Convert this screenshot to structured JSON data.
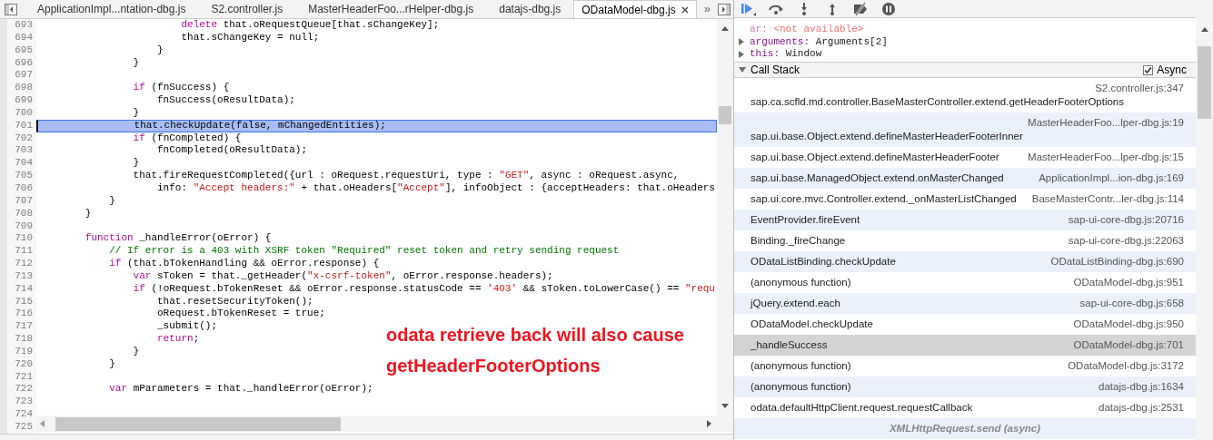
{
  "editor": {
    "tabs": [
      {
        "label": "ApplicationImpl...ntation-dbg.js",
        "selected": false
      },
      {
        "label": "S2.controller.js",
        "selected": false
      },
      {
        "label": "MasterHeaderFoo...rHelper-dbg.js",
        "selected": false
      },
      {
        "label": "datajs-dbg.js",
        "selected": false
      },
      {
        "label": "ODataModel-dbg.js",
        "selected": true
      }
    ],
    "overflow": "»",
    "lines": [
      {
        "number": "693",
        "selected": false,
        "tokens": [
          {
            "kind": "keyword",
            "text": "                        delete"
          },
          {
            "kind": "plain",
            "text": " that.oRequestQueue[that.sChangeKey];"
          }
        ]
      },
      {
        "number": "694",
        "selected": false,
        "tokens": [
          {
            "kind": "plain",
            "text": "                        that.sChangeKey = null;"
          }
        ]
      },
      {
        "number": "695",
        "selected": false,
        "tokens": [
          {
            "kind": "plain",
            "text": "                    }"
          }
        ]
      },
      {
        "number": "696",
        "selected": false,
        "tokens": [
          {
            "kind": "plain",
            "text": "                }"
          }
        ]
      },
      {
        "number": "697",
        "selected": false
      },
      {
        "number": "698",
        "selected": false,
        "tokens": [
          {
            "kind": "keyword",
            "text": "                if"
          },
          {
            "kind": "plain",
            "text": " (fnSuccess) {"
          }
        ]
      },
      {
        "number": "699",
        "selected": false,
        "tokens": [
          {
            "kind": "plain",
            "text": "                    fnSuccess(oResultData);"
          }
        ]
      },
      {
        "number": "700",
        "selected": false,
        "tokens": [
          {
            "kind": "plain",
            "text": "                }"
          }
        ]
      },
      {
        "number": "701",
        "selected": true,
        "tokens": [
          {
            "kind": "plain",
            "text": "                that.checkUpdate(false, mChangedEntities);"
          }
        ]
      },
      {
        "number": "702",
        "selected": false,
        "tokens": [
          {
            "kind": "keyword",
            "text": "                if"
          },
          {
            "kind": "plain",
            "text": " (fnCompleted) {"
          }
        ]
      },
      {
        "number": "703",
        "selected": false,
        "tokens": [
          {
            "kind": "plain",
            "text": "                    fnCompleted(oResultData);"
          }
        ]
      },
      {
        "number": "704",
        "selected": false,
        "tokens": [
          {
            "kind": "plain",
            "text": "                }"
          }
        ]
      },
      {
        "number": "705",
        "selected": false,
        "tokens": [
          {
            "kind": "plain",
            "text": "                that.fireRequestCompleted({url : oRequest.requestUri, type : "
          },
          {
            "kind": "string",
            "text": "\"GET\""
          },
          {
            "kind": "plain",
            "text": ", async : oRequest.async,"
          }
        ]
      },
      {
        "number": "706",
        "selected": false,
        "tokens": [
          {
            "kind": "plain",
            "text": "                    info: "
          },
          {
            "kind": "string",
            "text": "\"Accept headers:\""
          },
          {
            "kind": "plain",
            "text": " + that.oHeaders["
          },
          {
            "kind": "string",
            "text": "\"Accept\""
          },
          {
            "kind": "plain",
            "text": "], infoObject : {acceptHeaders: that.oHeaders"
          }
        ]
      },
      {
        "number": "707",
        "selected": false,
        "tokens": [
          {
            "kind": "plain",
            "text": "            }"
          }
        ]
      },
      {
        "number": "708",
        "selected": false,
        "tokens": [
          {
            "kind": "plain",
            "text": "        }"
          }
        ]
      },
      {
        "number": "709",
        "selected": false
      },
      {
        "number": "710",
        "selected": false,
        "tokens": [
          {
            "kind": "keyword",
            "text": "        function"
          },
          {
            "kind": "plain",
            "text": " _handleError(oError) {"
          }
        ]
      },
      {
        "number": "711",
        "selected": false,
        "tokens": [
          {
            "kind": "comment",
            "text": "            // If error is a 403 with XSRF token \"Required\" reset token and retry sending request"
          }
        ]
      },
      {
        "number": "712",
        "selected": false,
        "tokens": [
          {
            "kind": "keyword",
            "text": "            if"
          },
          {
            "kind": "plain",
            "text": " (that.bTokenHandling && oError.response) {"
          }
        ]
      },
      {
        "number": "713",
        "selected": false,
        "tokens": [
          {
            "kind": "keyword",
            "text": "                var"
          },
          {
            "kind": "plain",
            "text": " sToken = that._getHeader("
          },
          {
            "kind": "string",
            "text": "\"x-csrf-token\""
          },
          {
            "kind": "plain",
            "text": ", oError.response.headers);"
          }
        ]
      },
      {
        "number": "714",
        "selected": false,
        "tokens": [
          {
            "kind": "keyword",
            "text": "                if"
          },
          {
            "kind": "plain",
            "text": " (!oRequest.bTokenReset && oError.response.statusCode == "
          },
          {
            "kind": "string",
            "text": "'403'"
          },
          {
            "kind": "plain",
            "text": " && sToken.toLowerCase() == "
          },
          {
            "kind": "string",
            "text": "\"requ"
          }
        ]
      },
      {
        "number": "715",
        "selected": false,
        "tokens": [
          {
            "kind": "plain",
            "text": "                    that.resetSecurityToken();"
          }
        ]
      },
      {
        "number": "716",
        "selected": false,
        "tokens": [
          {
            "kind": "plain",
            "text": "                    oRequest.bTokenReset = true;"
          }
        ]
      },
      {
        "number": "717",
        "selected": false,
        "tokens": [
          {
            "kind": "plain",
            "text": "                    _submit();"
          }
        ]
      },
      {
        "number": "718",
        "selected": false,
        "tokens": [
          {
            "kind": "keyword",
            "text": "                    return"
          },
          {
            "kind": "plain",
            "text": ";"
          }
        ]
      },
      {
        "number": "719",
        "selected": false,
        "tokens": [
          {
            "kind": "plain",
            "text": "                }"
          }
        ]
      },
      {
        "number": "720",
        "selected": false,
        "tokens": [
          {
            "kind": "plain",
            "text": "            }"
          }
        ]
      },
      {
        "number": "721",
        "selected": false
      },
      {
        "number": "722",
        "selected": false,
        "tokens": [
          {
            "kind": "keyword",
            "text": "            var"
          },
          {
            "kind": "plain",
            "text": " mParameters = that._handleError(oError);"
          }
        ]
      },
      {
        "number": "723",
        "selected": false
      },
      {
        "number": "724",
        "selected": false
      },
      {
        "number": "725",
        "selected": false
      }
    ],
    "annotation": [
      "odata retrieve back will also cause",
      "getHeaderFooterOptions"
    ]
  },
  "debugger": {
    "scope": [
      {
        "kind": "unavailable",
        "name": "ar:",
        "value": "<not available>"
      },
      {
        "kind": "object",
        "name": "arguments:",
        "value": "Arguments[2]"
      },
      {
        "kind": "object",
        "name": "this:",
        "value": "Window"
      }
    ],
    "call_stack": {
      "title": "Call Stack",
      "expanded": true,
      "async": {
        "label": "Async",
        "checked": true
      },
      "frames": [
        {
          "name": "sap.ca.scfld.md.controller.BaseMasterController.extend.getHeaderFooterOptions",
          "location": "S2.controller.js:347",
          "selected": false
        },
        {
          "name": "sap.ui.base.Object.extend.defineMasterHeaderFooterInner",
          "location": "MasterHeaderFoo...lper-dbg.js:19",
          "selected": false
        },
        {
          "name": "sap.ui.base.Object.extend.defineMasterHeaderFooter",
          "location": "MasterHeaderFoo...lper-dbg.js:15",
          "selected": false
        },
        {
          "name": "sap.ui.base.ManagedObject.extend.onMasterChanged",
          "location": "ApplicationImpl...ion-dbg.js:169",
          "selected": false
        },
        {
          "name": "sap.ui.core.mvc.Controller.extend._onMasterListChanged",
          "location": "BaseMasterContr...ler-dbg.js:114",
          "selected": false
        },
        {
          "name": "EventProvider.fireEvent",
          "location": "sap-ui-core-dbg.js:20716",
          "selected": false
        },
        {
          "name": "Binding._fireChange",
          "location": "sap-ui-core-dbg.js:22063",
          "selected": false
        },
        {
          "name": "ODataListBinding.checkUpdate",
          "location": "ODataListBinding-dbg.js:690",
          "selected": false
        },
        {
          "name": "(anonymous function)",
          "location": "ODataModel-dbg.js:951",
          "selected": false
        },
        {
          "name": "jQuery.extend.each",
          "location": "sap-ui-core-dbg.js:658",
          "selected": false
        },
        {
          "name": "ODataModel.checkUpdate",
          "location": "ODataModel-dbg.js:950",
          "selected": false
        },
        {
          "name": "_handleSuccess",
          "location": "ODataModel-dbg.js:701",
          "selected": true
        },
        {
          "name": "(anonymous function)",
          "location": "ODataModel-dbg.js:3172",
          "selected": false
        },
        {
          "name": "(anonymous function)",
          "location": "datajs-dbg.js:1634",
          "selected": false
        },
        {
          "name": "odata.defaultHttpClient.request.requestCallback",
          "location": "datajs-dbg.js:2531",
          "selected": false
        }
      ],
      "async_label": "XMLHttpRequest.send (async)"
    }
  }
}
